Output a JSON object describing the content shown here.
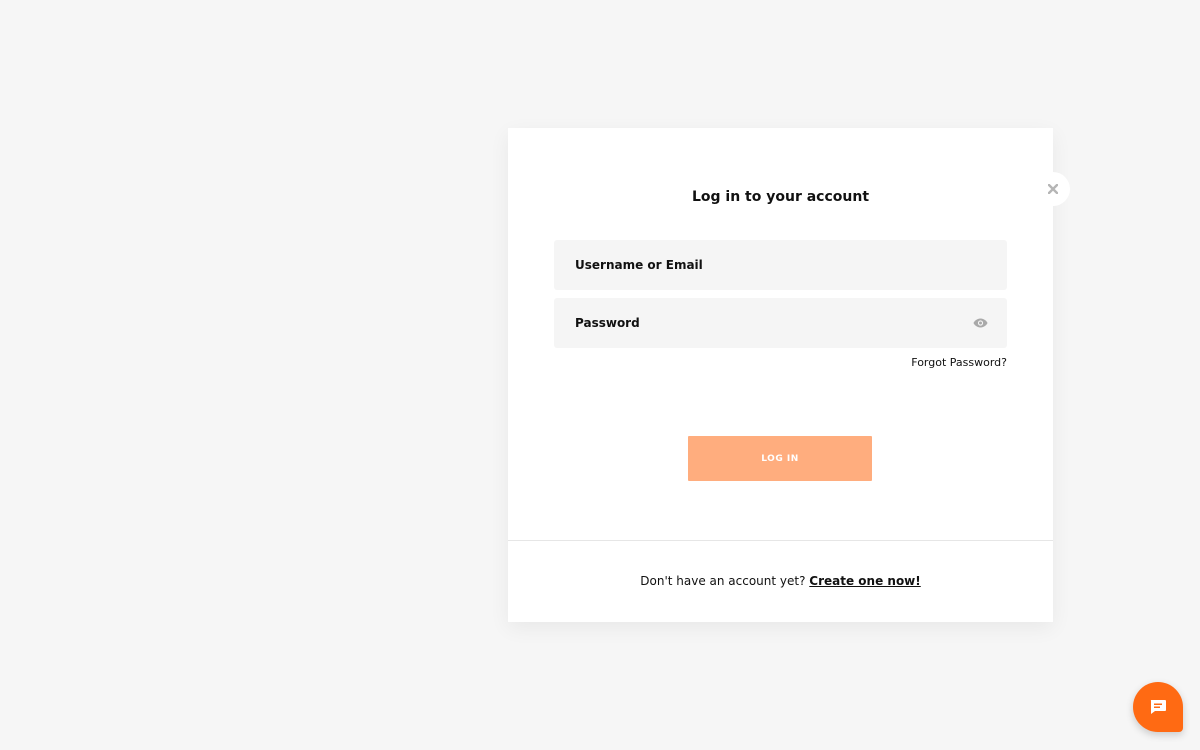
{
  "modal": {
    "title": "Log in to your account",
    "username_placeholder": "Username or Email",
    "password_placeholder": "Password",
    "forgot_label": "Forgot Password?",
    "login_label": "LOG IN",
    "footer_prompt": "Don't have an account yet? ",
    "footer_link": "Create one now!"
  },
  "icons": {
    "close": "close-icon",
    "eye": "eye-icon",
    "chat": "chat-icon"
  },
  "colors": {
    "accent": "#ff6a13",
    "login_button": "#ffad7e",
    "field_bg": "#f5f5f5",
    "page_bg": "#f6f6f6"
  }
}
